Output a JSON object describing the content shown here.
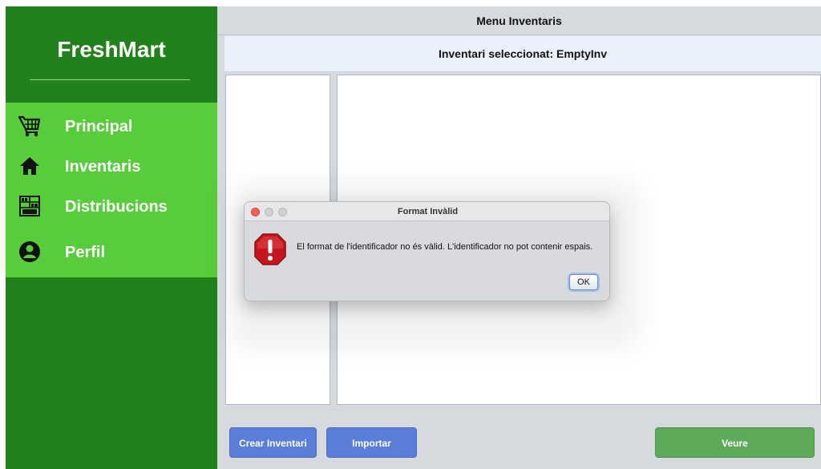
{
  "sidebar": {
    "brand": "FreshMart",
    "items": [
      {
        "label": "Principal",
        "icon": "shopping-cart-icon"
      },
      {
        "label": "Inventaris",
        "icon": "home-icon"
      },
      {
        "label": "Distribucions",
        "icon": "store-shelves-icon"
      },
      {
        "label": "Perfil",
        "icon": "user-profile-icon"
      }
    ],
    "colors": {
      "dark": "#21821b",
      "light": "#58cd3b"
    }
  },
  "main": {
    "title": "Menu Inventaris",
    "selected_label": "Inventari seleccionat: EmptyInv",
    "buttons": {
      "create": "Crear Inventari",
      "import": "Importar",
      "view": "Veure"
    }
  },
  "dialog": {
    "title": "Format Invàlid",
    "message": "El format de l'identificador no és vàlid. L'identificador no pot contenir espais.",
    "ok_label": "OK",
    "icon": "warning-icon"
  }
}
